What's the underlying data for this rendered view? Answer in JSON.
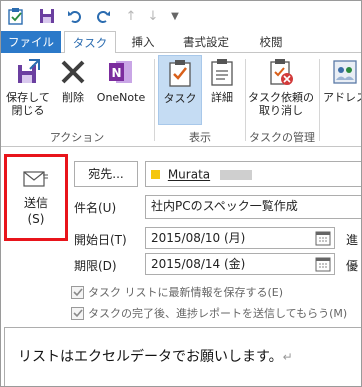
{
  "tabs": {
    "file": "ファイル",
    "task": "タスク",
    "insert": "挿入",
    "format": "書式設定",
    "review": "校閲"
  },
  "ribbon": {
    "save_close": [
      "保存して",
      "閉じる"
    ],
    "delete": "削除",
    "onenote": "OneNote",
    "task": "タスク",
    "details": "詳細",
    "cancel_assign": [
      "タスク依頼の",
      "取り消し"
    ],
    "address": "アドレス",
    "group_action": "アクション",
    "group_show": "表示",
    "group_manage": "タスクの管理"
  },
  "form": {
    "send_label": "送信",
    "send_key": "(S)",
    "to_button": "宛先...",
    "to_value": "Murata",
    "subject_label": "件名(U)",
    "subject_value": "社内PCのスペック一覧作成",
    "start_label": "開始日(T)",
    "start_value": "2015/08/10 (月)",
    "due_label": "期限(D)",
    "due_value": "2015/08/14 (金)",
    "right_cut_1": "進",
    "right_cut_2": "優",
    "check1": "タスク リストに最新情報を保存する(E)",
    "check2": "タスクの完了後、進捗レポートを送信してもらう(M)",
    "body": "リストはエクセルデータでお願いします。"
  },
  "colors": {
    "accent": "#2b79c9",
    "highlight": "#e8141b",
    "selected": "#c5dcf3"
  }
}
